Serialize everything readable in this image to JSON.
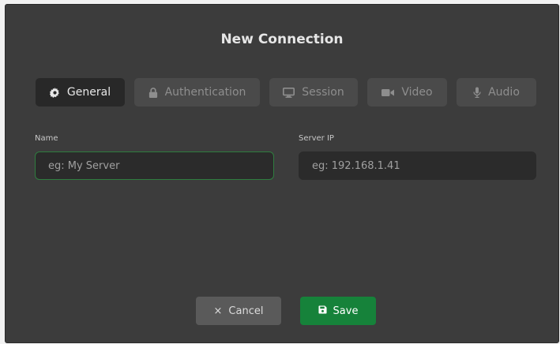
{
  "dialog": {
    "title": "New Connection"
  },
  "tabs": [
    {
      "label": "General",
      "icon": "gear-icon",
      "active": true
    },
    {
      "label": "Authentication",
      "icon": "lock-icon",
      "active": false
    },
    {
      "label": "Session",
      "icon": "monitor-icon",
      "active": false
    },
    {
      "label": "Video",
      "icon": "video-camera-icon",
      "active": false
    },
    {
      "label": "Audio",
      "icon": "microphone-icon",
      "active": false
    }
  ],
  "form": {
    "name": {
      "label": "Name",
      "placeholder": "eg: My Server",
      "value": ""
    },
    "server_ip": {
      "label": "Server IP",
      "placeholder": "eg: 192.168.1.41",
      "value": ""
    }
  },
  "actions": {
    "cancel_label": "Cancel",
    "save_label": "Save"
  },
  "colors": {
    "background": "#3c3c3c",
    "tab_active": "#282828",
    "tab_inactive": "#4a4a4a",
    "field_focus_border": "#2f7d3f",
    "save_button": "#16823a",
    "cancel_button": "#5a5a5a"
  }
}
